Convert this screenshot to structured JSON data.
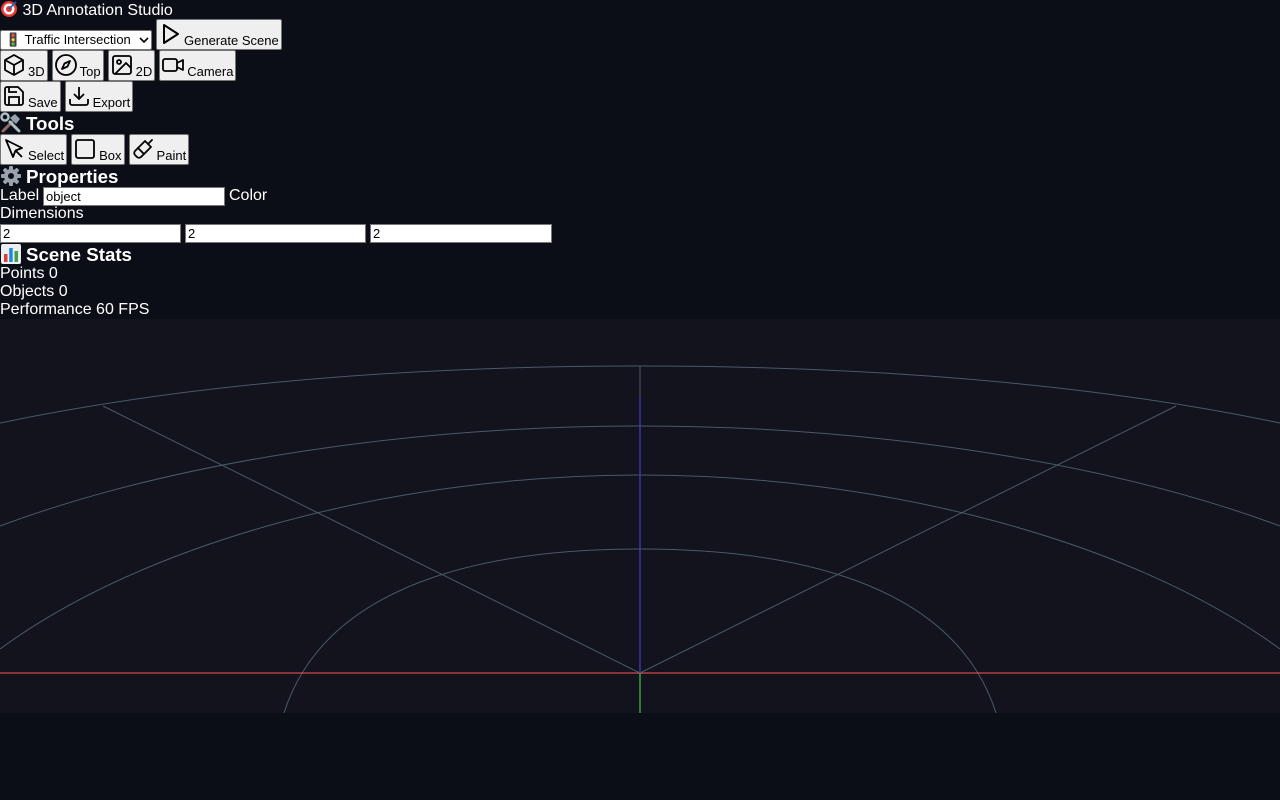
{
  "app": {
    "title": "3D Annotation Studio",
    "logo_icon": "target-icon"
  },
  "toolbar": {
    "scene_select": {
      "selected": "🚦 Traffic Intersection",
      "icon": "traffic-light-icon"
    },
    "generate_label": "Generate Scene",
    "view_buttons": [
      {
        "label": "3D",
        "icon": "cube-icon"
      },
      {
        "label": "Top",
        "icon": "compass-icon"
      },
      {
        "label": "2D",
        "icon": "image-icon"
      },
      {
        "label": "Camera",
        "icon": "video-camera-icon"
      }
    ],
    "save_label": "Save",
    "export_label": "Export"
  },
  "tools": {
    "heading": "Tools",
    "heading_icon": "tools-icon",
    "items": [
      {
        "label": "Select",
        "icon": "cursor-icon"
      },
      {
        "label": "Box",
        "icon": "square-icon"
      },
      {
        "label": "Paint",
        "icon": "paintbrush-icon"
      }
    ]
  },
  "properties": {
    "heading": "Properties",
    "heading_icon": "gear-icon",
    "label_text": "Label",
    "label_value": "object",
    "color_text": "Color",
    "dimensions_text": "Dimensions",
    "dimensions": [
      "2",
      "2",
      "2"
    ]
  },
  "stats": {
    "heading": "Scene Stats",
    "heading_icon": "bar-chart-icon",
    "points_label": "Points",
    "points_value": "0",
    "objects_label": "Objects",
    "objects_value": "0",
    "performance_label": "Performance",
    "performance_value": "60 FPS"
  },
  "colors": {
    "background": "#0b0e17",
    "viewport": "#12131d",
    "grid": "#4a5a66",
    "axis_x": "#d24848",
    "axis_y": "#3c3cc8",
    "axis_z": "#3cb43c"
  }
}
